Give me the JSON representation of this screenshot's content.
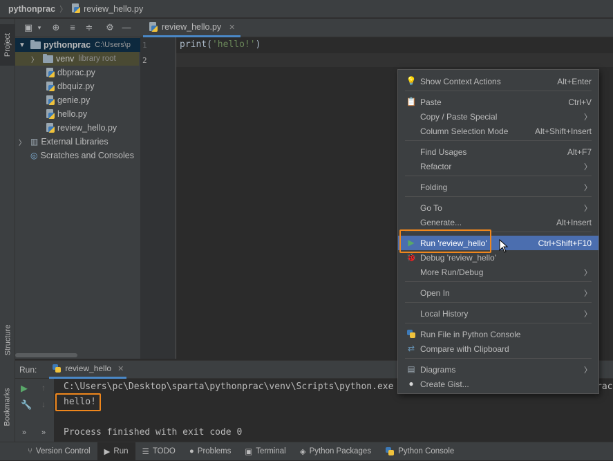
{
  "titlebar": {
    "project": "pythonprac",
    "file": "review_hello.py"
  },
  "left_strip": {
    "project_tab": "Project",
    "structure_tab": "Structure",
    "bookmarks_tab": "Bookmarks"
  },
  "project_tree": {
    "root": {
      "name": "pythonprac",
      "path": "C:\\Users\\p"
    },
    "venv": {
      "name": "venv",
      "hint": "library root"
    },
    "files": [
      "dbprac.py",
      "dbquiz.py",
      "genie.py",
      "hello.py",
      "review_hello.py"
    ],
    "external": "External Libraries",
    "scratches": "Scratches and Consoles"
  },
  "editor": {
    "tab": "review_hello.py",
    "line_numbers": [
      "1",
      "2"
    ],
    "code": {
      "fn": "print(",
      "str": "'hello!'",
      "close": ")"
    }
  },
  "context_menu": {
    "items": [
      {
        "label": "Show Context Actions",
        "shortcut": "Alt+Enter",
        "icon": "lightbulb-icon"
      },
      {
        "label": "Paste",
        "shortcut": "Ctrl+V",
        "icon": "clipboard-icon"
      },
      {
        "label": "Copy / Paste Special",
        "shortcut": "",
        "submenu": true
      },
      {
        "label": "Column Selection Mode",
        "shortcut": "Alt+Shift+Insert"
      },
      {
        "label": "Find Usages",
        "shortcut": "Alt+F7"
      },
      {
        "label": "Refactor",
        "shortcut": "",
        "submenu": true
      },
      {
        "label": "Folding",
        "shortcut": "",
        "submenu": true
      },
      {
        "label": "Go To",
        "shortcut": "",
        "submenu": true
      },
      {
        "label": "Generate...",
        "shortcut": "Alt+Insert"
      },
      {
        "label": "Run 'review_hello'",
        "shortcut": "Ctrl+Shift+F10",
        "icon": "run-icon",
        "selected": true
      },
      {
        "label": "Debug 'review_hello'",
        "shortcut": "",
        "icon": "debug-icon"
      },
      {
        "label": "More Run/Debug",
        "shortcut": "",
        "submenu": true
      },
      {
        "label": "Open In",
        "shortcut": "",
        "submenu": true
      },
      {
        "label": "Local History",
        "shortcut": "",
        "submenu": true
      },
      {
        "label": "Run File in Python Console",
        "shortcut": "",
        "icon": "python-icon"
      },
      {
        "label": "Compare with Clipboard",
        "shortcut": "",
        "icon": "compare-icon"
      },
      {
        "label": "Diagrams",
        "shortcut": "",
        "submenu": true,
        "icon": "diagram-icon"
      },
      {
        "label": "Create Gist...",
        "shortcut": "",
        "icon": "github-icon"
      }
    ]
  },
  "run_panel": {
    "label": "Run:",
    "tab": "review_hello",
    "command": "C:\\Users\\pc\\Desktop\\sparta\\pythonprac\\venv\\Scripts\\python.exe",
    "command_tail": "rac/",
    "output": "hello!",
    "exit": "Process finished with exit code 0"
  },
  "bottom_tabs": [
    "Version Control",
    "Run",
    "TODO",
    "Problems",
    "Terminal",
    "Python Packages",
    "Python Console"
  ],
  "colors": {
    "highlight": "#f0871c",
    "selection": "#4b6eaf"
  }
}
